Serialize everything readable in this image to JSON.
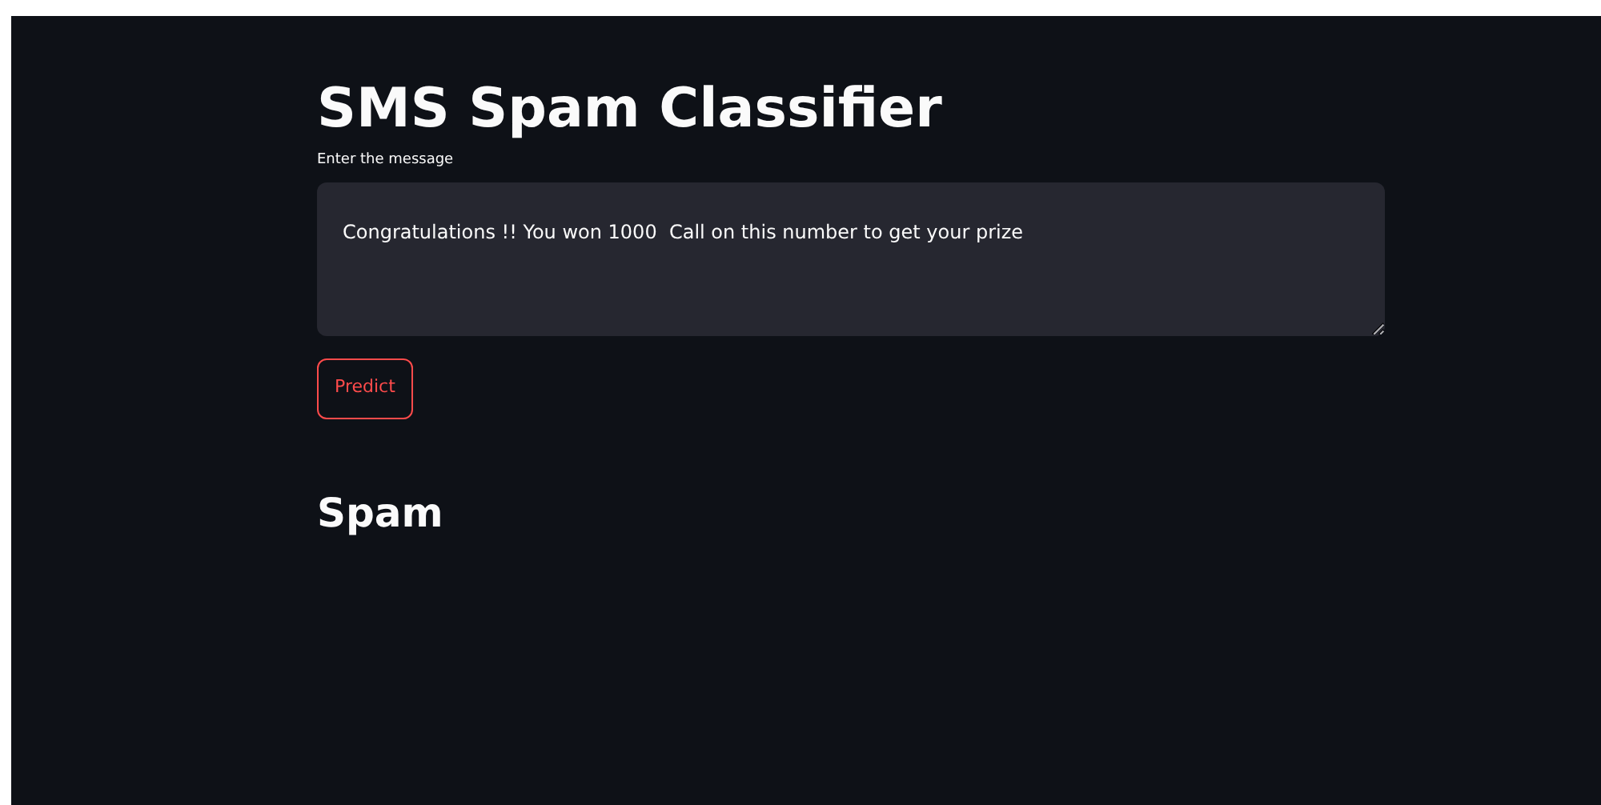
{
  "title": "SMS Spam Classifier",
  "message_field": {
    "label": "Enter the message",
    "value": "Congratulations !! You won 1000  Call on this number to get your prize"
  },
  "predict_button": {
    "label": "Predict"
  },
  "result": "Spam"
}
